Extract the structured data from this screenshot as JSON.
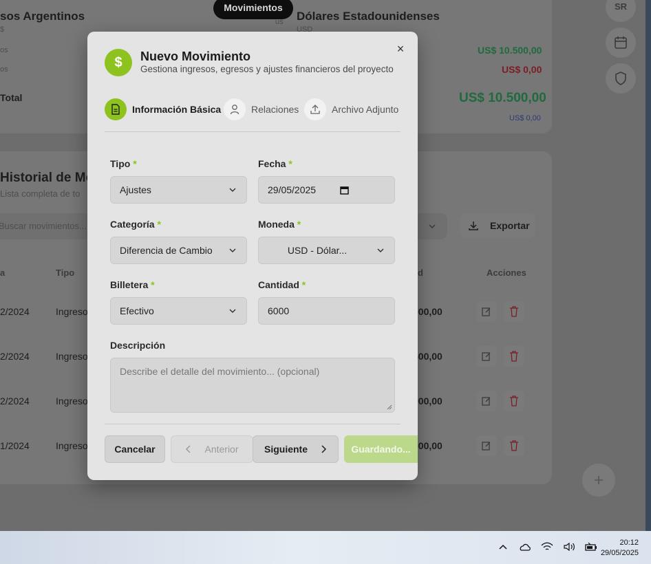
{
  "background": {
    "top_card": {
      "left_title": "sos Argentinos",
      "left_sub": "$",
      "left_rows": [
        "os",
        "os"
      ],
      "left_total": "Total",
      "badge_code": "us",
      "right_title": "Dólares Estadounidenses",
      "right_sub": "USD",
      "income_value": "US$ 10.500,00",
      "expense_value": "US$ 0,00",
      "total_value": "US$ 10.500,00",
      "small_value": "US$ 0,00"
    },
    "movements_pill": "Movimientos",
    "avatar_initials": "SR",
    "history": {
      "title": "Historial de Mo",
      "subtitle": "Lista completa de to",
      "search_placeholder": "Buscar movimientos...",
      "export_label": "Exportar",
      "columns": [
        "a",
        "Tipo",
        "d",
        "Acciones"
      ],
      "rows": [
        {
          "date": "2/2024",
          "type": "Ingreso",
          "amount": "000,00"
        },
        {
          "date": "2/2024",
          "type": "Ingreso",
          "amount": "500,00"
        },
        {
          "date": "2/2024",
          "type": "Ingreso",
          "amount": "000,00"
        },
        {
          "date": "1/2024",
          "type": "Ingreso",
          "amount": "000,00"
        }
      ]
    }
  },
  "modal": {
    "icon": "$",
    "title": "Nuevo Movimiento",
    "subtitle": "Gestiona ingresos, egresos y ajustes financieros del proyecto",
    "close": "×",
    "steps": [
      {
        "label": "Información Básica",
        "icon": "document-icon",
        "active": true
      },
      {
        "label": "Relaciones",
        "icon": "user-icon",
        "active": false
      },
      {
        "label": "Archivo Adjunto",
        "icon": "upload-icon",
        "active": false
      }
    ],
    "fields": {
      "tipo": {
        "label": "Tipo",
        "value": "Ajustes"
      },
      "fecha": {
        "label": "Fecha",
        "value": "29/05/2025"
      },
      "categoria": {
        "label": "Categoría",
        "value": "Diferencia de Cambio"
      },
      "moneda": {
        "label": "Moneda",
        "value": "USD - Dólar..."
      },
      "billetera": {
        "label": "Billetera",
        "value": "Efectivo"
      },
      "cantidad": {
        "label": "Cantidad",
        "value": "6000"
      },
      "descripcion": {
        "label": "Descripción",
        "placeholder": "Describe el detalle del movimiento... (opcional)"
      }
    },
    "required_mark": "*",
    "buttons": {
      "cancel": "Cancelar",
      "previous": "Anterior",
      "next": "Siguiente",
      "save": "Guardando..."
    }
  },
  "taskbar": {
    "time": "20:12",
    "date": "29/05/2025"
  },
  "colors": {
    "accent": "#8dc21f",
    "income": "#1f8a4a",
    "expense": "#c0182a",
    "link_blue": "#2a3f9a"
  }
}
